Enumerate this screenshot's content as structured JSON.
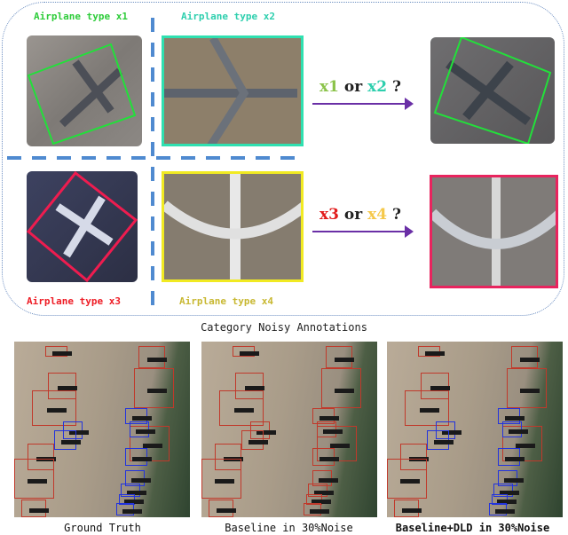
{
  "top_panel": {
    "types": [
      {
        "id": "x1",
        "label": "Airplane type x1",
        "color": "#2ecc3a"
      },
      {
        "id": "x2",
        "label": "Airplane type x2",
        "color": "#2ecfae"
      },
      {
        "id": "x3",
        "label": "Airplane type x3",
        "color": "#ee1c25"
      },
      {
        "id": "x4",
        "label": "Airplane type x4",
        "color": "#c8b832"
      }
    ],
    "questions": [
      {
        "left": "x1",
        "mid": "or",
        "right": "x2",
        "mark": "?",
        "left_color": "#8bc34a",
        "right_color": "#2ecfae"
      },
      {
        "left": "x3",
        "mid": "or",
        "right": "x4",
        "mark": "?",
        "left_color": "#e21b1b",
        "right_color": "#f5c84a"
      }
    ],
    "arrow_color": "#6a2fa6",
    "divider_color": "#4f8ad0"
  },
  "section_title": "Category Noisy Annotations",
  "detection_panels": [
    {
      "caption": "Ground Truth",
      "bold": false
    },
    {
      "caption": "Baseline in 30%Noise",
      "bold": false
    },
    {
      "caption": "Baseline+DLD in 30%Noise",
      "bold": true
    }
  ],
  "box_colors": {
    "correct": "#c0392b",
    "noisy": "#2233dd"
  }
}
